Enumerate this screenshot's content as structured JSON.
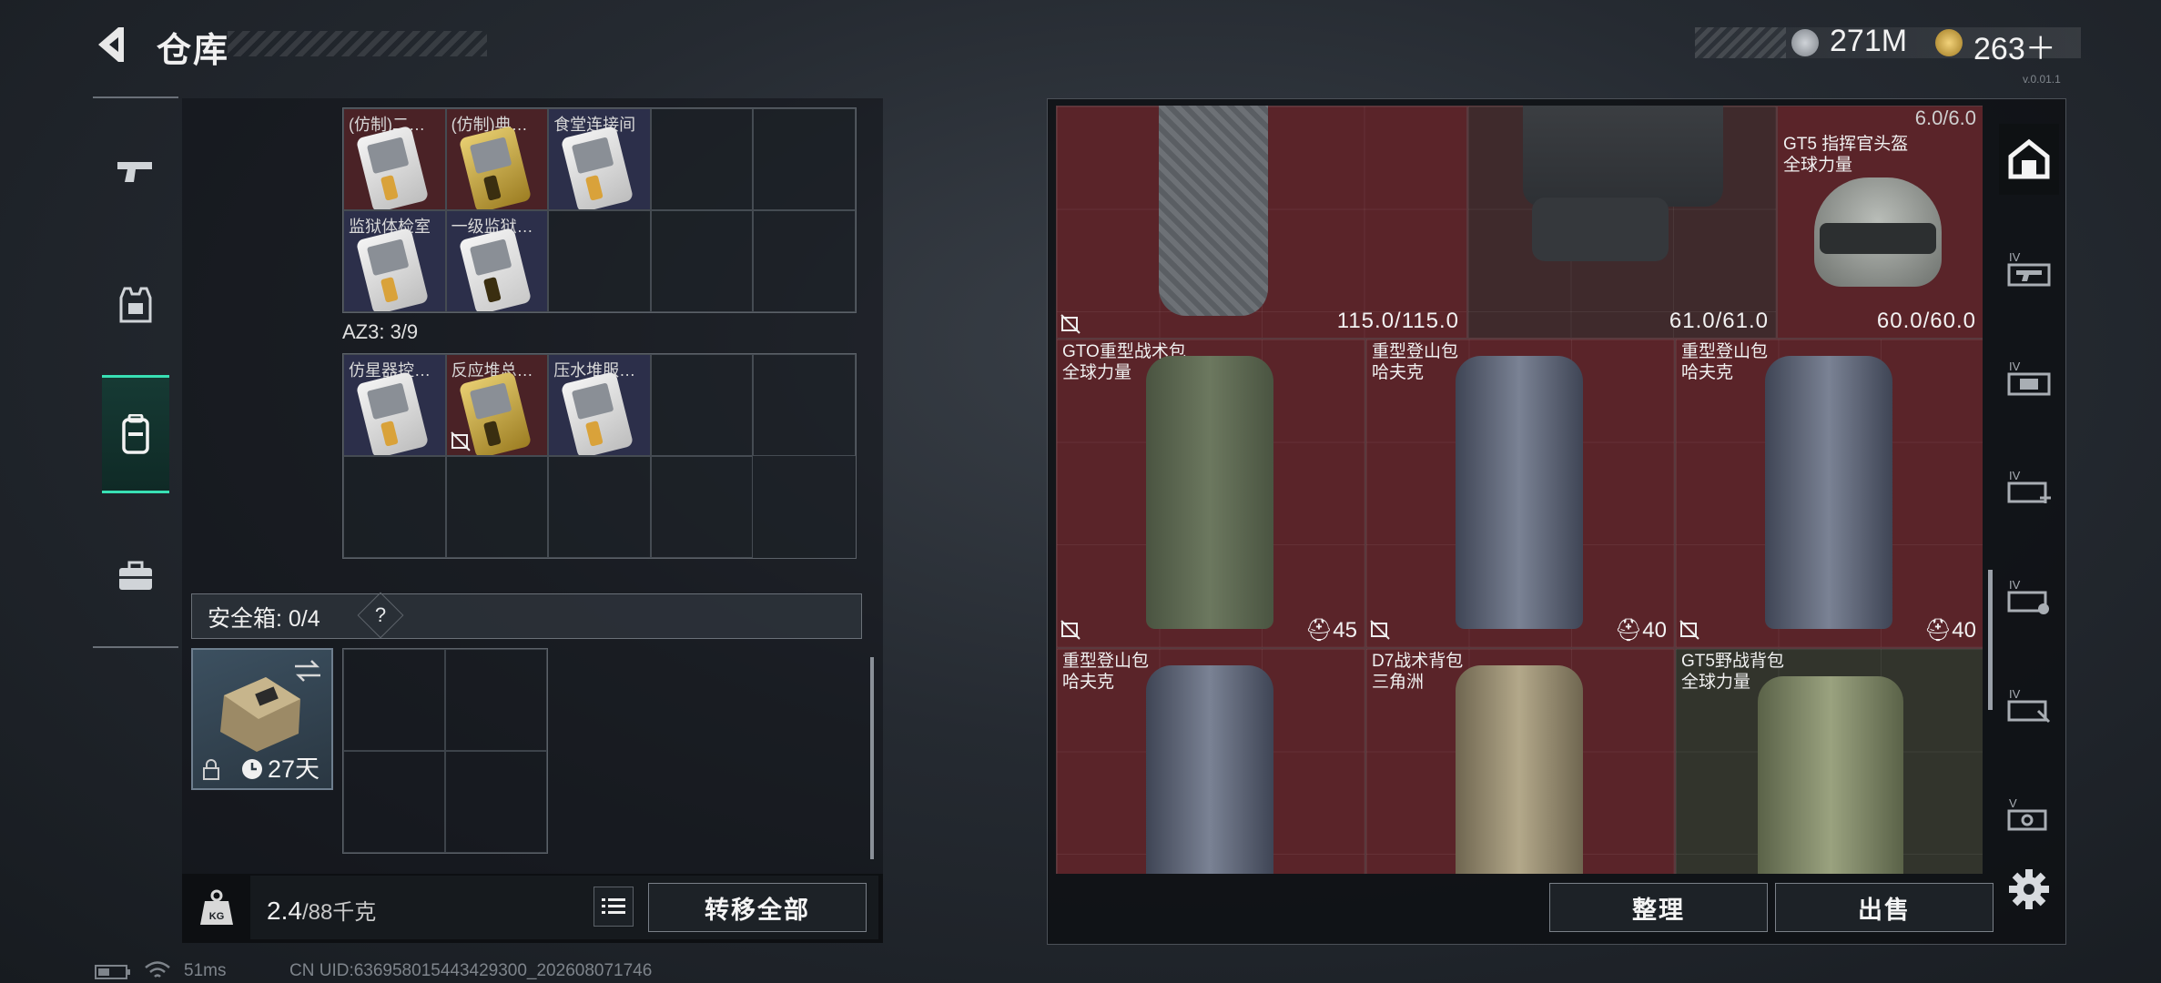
{
  "header": {
    "title": "仓库",
    "currency_1": "271M",
    "currency_2": "263＋"
  },
  "version_tag": "v.0.01.1",
  "left_nav": {
    "items": [
      {
        "name": "weapon"
      },
      {
        "name": "armor"
      },
      {
        "name": "backpack",
        "active": true
      },
      {
        "name": "toolbox"
      }
    ]
  },
  "cards_grid_1": [
    {
      "label": "(仿制)二…",
      "style": "red",
      "card": "white"
    },
    {
      "label": "(仿制)典…",
      "style": "red",
      "card": "gold"
    },
    {
      "label": "食堂连接间",
      "style": "blue",
      "card": "white"
    },
    {
      "label": "",
      "style": "",
      "card": ""
    },
    {
      "label": "",
      "style": "",
      "card": ""
    },
    {
      "label": "监狱体检室",
      "style": "blue",
      "card": "white"
    },
    {
      "label": "一级监狱…",
      "style": "blue",
      "card": "white"
    },
    {
      "label": "",
      "style": "",
      "card": ""
    },
    {
      "label": "",
      "style": "",
      "card": ""
    },
    {
      "label": "",
      "style": "",
      "card": ""
    }
  ],
  "az3_label": "AZ3: 3/9",
  "cards_grid_2": [
    {
      "label": "仿星器控…",
      "style": "blue",
      "card": "white"
    },
    {
      "label": "反应堆总…",
      "style": "red",
      "card": "gold",
      "no_insure": true
    },
    {
      "label": "压水堆服…",
      "style": "blue",
      "card": "white"
    }
  ],
  "safe_box": {
    "label": "安全箱: 0/4",
    "help": "?",
    "timer": "27天"
  },
  "weight": {
    "current": "2.4",
    "max": "/88千克"
  },
  "buttons": {
    "transfer_all": "转移全部",
    "sort": "整理",
    "sell": "出售"
  },
  "stash_items": [
    {
      "name": "",
      "brand": "",
      "dur": "115.0/115.0",
      "type": "vest",
      "no_insure": true
    },
    {
      "name": "",
      "brand": "",
      "dur": "61.0/61.0",
      "type": "rig"
    },
    {
      "name": "GT5 指挥官头盔",
      "brand": "全球力量",
      "dur": "60.0/60.0",
      "type": "helmet",
      "top": "6.0/6.0"
    },
    {
      "name": "GTO重型战术包",
      "brand": "全球力量",
      "cap": "45",
      "color": "#5b6651",
      "no_insure": true
    },
    {
      "name": "重型登山包",
      "brand": "哈夫克",
      "cap": "40",
      "color": "#5a6274",
      "no_insure": true
    },
    {
      "name": "重型登山包",
      "brand": "哈夫克",
      "cap": "40",
      "color": "#5a6274",
      "no_insure": true
    },
    {
      "name": "重型登山包",
      "brand": "哈夫克",
      "color": "#5a6274"
    },
    {
      "name": "D7战术背包",
      "brand": "三角洲",
      "color": "#8b8168"
    },
    {
      "name": "GT5野战背包",
      "brand": "全球力量",
      "color": "#6d7558"
    }
  ],
  "status_bar": {
    "ping": "51ms",
    "uid": "CN UID:636958015443429300_202608071746"
  }
}
